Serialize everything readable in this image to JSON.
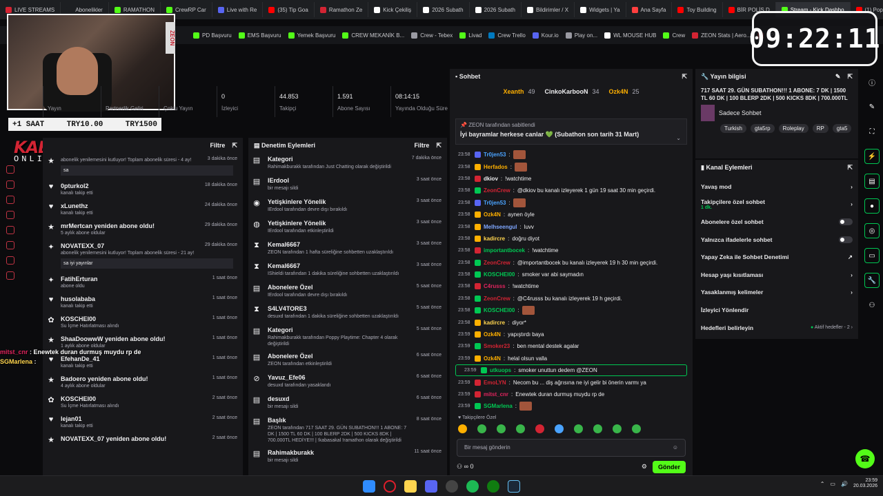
{
  "browser": {
    "tabs": [
      {
        "label": "LIVE STREAMS",
        "color": "#d32433"
      },
      {
        "label": "Abonelikler",
        "color": "#1d1f22"
      },
      {
        "label": "RAMATHON",
        "color": "#53fc18"
      },
      {
        "label": "CrewRP Car",
        "color": "#53fc18"
      },
      {
        "label": "Live with Re",
        "color": "#5865f2"
      },
      {
        "label": "(35) Tip Goa",
        "color": "#ff0000"
      },
      {
        "label": "Ramathon Ze",
        "color": "#d32433"
      },
      {
        "label": "Kick Çekiliş",
        "color": "#ffffff"
      },
      {
        "label": "2026 Subath",
        "color": "#ffffff"
      },
      {
        "label": "2026 Subath",
        "color": "#ffffff"
      },
      {
        "label": "Bildirimler / X",
        "color": "#ffffff"
      },
      {
        "label": "Widgets | Ya",
        "color": "#ffffff"
      },
      {
        "label": "Ana Sayfa",
        "color": "#ff3f3f"
      },
      {
        "label": "Toy Building",
        "color": "#ff0000"
      },
      {
        "label": "BİR POLİS D",
        "color": "#ff0000"
      },
      {
        "label": "Stream - Kick Dashbo",
        "color": "#53fc18",
        "active": true
      },
      {
        "label": "(1) Poppy Pl",
        "color": "#ff0000"
      }
    ],
    "bookmarks": [
      {
        "label": "PD Başvuru",
        "color": "#53fc18"
      },
      {
        "label": "EMS Başvuru",
        "color": "#53fc18"
      },
      {
        "label": "Yemek Başvuru",
        "color": "#53fc18"
      },
      {
        "label": "CREW MEKANİK B...",
        "color": "#53fc18"
      },
      {
        "label": "Crew - Tebex",
        "color": "#9a9aa2"
      },
      {
        "label": "Livad",
        "color": "#53fc18"
      },
      {
        "label": "Crew Trello",
        "color": "#0079bf"
      },
      {
        "label": "Kour.io",
        "color": "#5865f2"
      },
      {
        "label": "Play on...",
        "color": "#9a9aa2"
      },
      {
        "label": "WL MOUSE HUB",
        "color": "#ffffff"
      },
      {
        "label": "Crew",
        "color": "#53fc18"
      },
      {
        "label": "ZEON Stats | Aero...",
        "color": "#d32433"
      },
      {
        "label": "APIq",
        "color": "#ff3f3f"
      }
    ]
  },
  "overlay": {
    "clock": "09:22:11",
    "tip_left": "+1 SAAT",
    "tip_mid": "TRY10.00",
    "tip_right": "TRY1500",
    "logo_big": "KABASAKAL",
    "logo_small": "ONLINE.COM",
    "cam_brand": "ZEON",
    "chat": [
      {
        "user": "mitst_cnr",
        "text": "Enewtek duran durmuş muydu rp de",
        "color": "#e0245e"
      },
      {
        "user": "SGMarlena",
        "text": "",
        "color": "#ffd54f"
      }
    ]
  },
  "stats": [
    {
      "value": "",
      "label": "Yayın"
    },
    {
      "value": "",
      "label": "Partnerlik Geliri"
    },
    {
      "value": "",
      "label": "Çoklu Yayın"
    },
    {
      "value": "0",
      "label": "İzleyici"
    },
    {
      "value": "44.853",
      "label": "Takipçi"
    },
    {
      "value": "1.591",
      "label": "Abone Sayısı"
    },
    {
      "value": "08:14:15",
      "label": "Yayında Olduğu Süre"
    }
  ],
  "activity": {
    "header_filter": "Filtre",
    "items": [
      {
        "icon": "★",
        "name": "",
        "sub": "abonelik yenilemesini kutluyor! Toplam abonelik süresi - 4 ay!",
        "time": "3 dakika önce",
        "msg": "sa"
      },
      {
        "icon": "♥",
        "name": "0pturkol2",
        "sub": "kanalı takip etti",
        "time": "18 dakika önce"
      },
      {
        "icon": "♥",
        "name": "xLunethz",
        "sub": "kanalı takip etti",
        "time": "24 dakika önce"
      },
      {
        "icon": "★",
        "name": "mrMertcan yeniden abone oldu!",
        "sub": "5 aylık abone oldular",
        "time": "29 dakika önce"
      },
      {
        "icon": "✦",
        "name": "NOVATEXX_07",
        "sub": "abonelik yenilemesini kutluyor! Toplam abonelik süresi - 21 ay!",
        "time": "29 dakika önce",
        "msg": "sa iyi yayınlar"
      },
      {
        "icon": "✦",
        "name": "FatihErturan",
        "sub": "abone oldu",
        "time": "1 saat önce"
      },
      {
        "icon": "♥",
        "name": "husolababa",
        "sub": "kanalı takip etti",
        "time": "1 saat önce"
      },
      {
        "icon": "✿",
        "name": "KOSCHEI00",
        "sub": "Su İçme Hatırlatması alındı",
        "time": "1 saat önce"
      },
      {
        "icon": "★",
        "name": "ShaaDoowwW yeniden abone oldu!",
        "sub": "1 aylık abone oldular",
        "time": "1 saat önce"
      },
      {
        "icon": "♥",
        "name": "EfehanDe_41",
        "sub": "kanalı takip etti",
        "time": "1 saat önce"
      },
      {
        "icon": "★",
        "name": "Badoero yeniden abone oldu!",
        "sub": "4 aylık abone oldular",
        "time": "1 saat önce"
      },
      {
        "icon": "✿",
        "name": "KOSCHEI00",
        "sub": "Su İçme Hatırlatması alındı",
        "time": "2 saat önce"
      },
      {
        "icon": "♥",
        "name": "lejan01",
        "sub": "kanalı takip etti",
        "time": "2 saat önce"
      },
      {
        "icon": "★",
        "name": "NOVATEXX_07 yeniden abone oldu!",
        "sub": "",
        "time": "2 saat önce"
      }
    ]
  },
  "moderation": {
    "title": "Denetim Eylemleri",
    "filter": "Filtre",
    "items": [
      {
        "icon": "▤",
        "name": "Kategori",
        "sub": "Rahimakburakk tarafından Just Chatting olarak değiştirildi",
        "time": "7 dakika önce"
      },
      {
        "icon": "▤",
        "name": "IErdool",
        "sub": "bir mesajı sildi",
        "time": "3 saat önce"
      },
      {
        "icon": "◉",
        "name": "Yetişkinlere Yönelik",
        "sub": "IErdool tarafından devre dışı bırakıldı",
        "time": "3 saat önce"
      },
      {
        "icon": "◍",
        "name": "Yetişkinlere Yönelik",
        "sub": "IErdool tarafından etkinleştirildi",
        "time": "3 saat önce"
      },
      {
        "icon": "⧗",
        "name": "Kemal6667",
        "sub": "ZEON tarafından 1 hafta süreliğine sohbetten uzaklaştırıldı",
        "time": "3 saat önce"
      },
      {
        "icon": "⧗",
        "name": "Kemal6667",
        "sub": "IShieldi tarafından 1 dakika süreliğine sohbetten uzaklaştırıldı",
        "time": "3 saat önce"
      },
      {
        "icon": "▤",
        "name": "Abonelere Özel",
        "sub": "IErdool tarafından devre dışı bırakıldı",
        "time": "5 saat önce"
      },
      {
        "icon": "⧗",
        "name": "S4LV4TORE3",
        "sub": "desuxd tarafından 1 dakika süreliğine sohbetten uzaklaştırıldı",
        "time": "5 saat önce"
      },
      {
        "icon": "▤",
        "name": "Kategori",
        "sub": "Rahimakburakk tarafından Poppy Playtime: Chapter 4 olarak değiştirildi",
        "time": "5 saat önce"
      },
      {
        "icon": "▤",
        "name": "Abonelere Özel",
        "sub": "ZEON tarafından etkinleştirildi",
        "time": "6 saat önce"
      },
      {
        "icon": "⊘",
        "name": "Yavuz_Efe06",
        "sub": "desuxd tarafından yasaklandı",
        "time": "6 saat önce"
      },
      {
        "icon": "▤",
        "name": "desuxd",
        "sub": "bir mesajı sildi",
        "time": "6 saat önce"
      },
      {
        "icon": "▤",
        "name": "Başlık",
        "sub": "ZEON tarafından 717 SAAT 29. GÜN SUBATHON!!! 1 ABONE: 7 DK | 1500 TL 60 DK | 100 BLERP 2DK | 500 KICKS 8DK | 700.000TL HEDİYE!!! | !kabasakal !ramathon olarak değiştirildi",
        "time": "8 saat önce"
      },
      {
        "icon": "▤",
        "name": "Rahimakburakk",
        "sub": "bir mesajı sildi",
        "time": "11 saat önce"
      }
    ]
  },
  "chat": {
    "title": "Sohbet",
    "leaders": [
      {
        "rank": "1",
        "name": "Xeanth",
        "count": "49",
        "color": "#ffb000"
      },
      {
        "rank": "",
        "name": "CinkoKarbooN",
        "count": "34",
        "color": "#efeff1"
      },
      {
        "rank": "",
        "name": "Ozk4N",
        "count": "25",
        "color": "#ffb000"
      }
    ],
    "pinned_by": "ZEON tarafından sabitlendi",
    "pinned_text": "İyi bayramlar herkese canlar 💚 (Subathon son tarih 31 Mart)",
    "messages": [
      {
        "t": "23:58",
        "u": "Tr0jen53",
        "c": "#4aa3ff",
        "m": "",
        "e": true,
        "b": "#5865f2"
      },
      {
        "t": "23:58",
        "u": "Herfados",
        "c": "#ffb000",
        "m": "",
        "e": true,
        "b": "#ffb000"
      },
      {
        "t": "23:58",
        "u": "dkiov",
        "c": "#efeff1",
        "m": "!watchtime",
        "b": "#d32433"
      },
      {
        "t": "23:58",
        "u": "ZeonCrew",
        "c": "#d32433",
        "m": "@dkiov bu kanalı izleyerek 1 gün 19 saat 30 min geçirdi.",
        "b": "#00c853"
      },
      {
        "t": "23:58",
        "u": "Tr0jen53",
        "c": "#4aa3ff",
        "m": "",
        "e": true,
        "b": "#5865f2"
      },
      {
        "t": "23:58",
        "u": "Ozk4N",
        "c": "#ffb000",
        "m": "aynen öyle",
        "b": "#ffb000"
      },
      {
        "t": "23:58",
        "u": "Melhseengul",
        "c": "#7fa7ff",
        "m": "luvv",
        "b": "#ffb000"
      },
      {
        "t": "23:58",
        "u": "kadircre",
        "c": "#ffd54f",
        "m": "doğru diyot",
        "b": "#ffb000"
      },
      {
        "t": "23:58",
        "u": "importantbocek",
        "c": "#00c853",
        "m": "!watchtime",
        "b": "#d32433"
      },
      {
        "t": "23:58",
        "u": "ZeonCrew",
        "c": "#d32433",
        "m": "@importantbocek bu kanalı izleyerek 19 h 30 min geçirdi.",
        "b": "#00c853"
      },
      {
        "t": "23:58",
        "u": "KOSCHEI00",
        "c": "#00c853",
        "m": "smoker var abi saymadın",
        "b": "#00c853"
      },
      {
        "t": "23:58",
        "u": "C4russs",
        "c": "#e0245e",
        "m": "!watchtime",
        "b": "#d32433"
      },
      {
        "t": "23:58",
        "u": "ZeonCrew",
        "c": "#d32433",
        "m": "@C4russs bu kanalı izleyerek 19 h geçirdi.",
        "b": "#00c853"
      },
      {
        "t": "23:58",
        "u": "KOSCHEI00",
        "c": "#00c853",
        "m": "",
        "e": true,
        "b": "#00c853"
      },
      {
        "t": "23:58",
        "u": "kadircre",
        "c": "#ffd54f",
        "m": "diyor*",
        "b": "#ffb000"
      },
      {
        "t": "23:59",
        "u": "Ozk4N",
        "c": "#ffb000",
        "m": "yapıştırdı baya",
        "b": "#ffb000"
      },
      {
        "t": "23:59",
        "u": "Smoker23",
        "c": "#d32433",
        "m": "ben mental destek agalar",
        "b": "#00c853"
      },
      {
        "t": "23:59",
        "u": "Ozk4N",
        "c": "#ffb000",
        "m": "helal olsun valla",
        "b": "#ffb000"
      },
      {
        "t": "23:59",
        "u": "utkuops",
        "c": "#00c853",
        "m": "smoker unuttun dedem @ZEON",
        "b": "#00c853",
        "sel": true
      },
      {
        "t": "23:59",
        "u": "EmoLYN",
        "c": "#d32433",
        "m": "Necom bu ... diş ağrısına ne iyi gelir bi önerin varmı ya",
        "b": "#d32433"
      },
      {
        "t": "23:59",
        "u": "mitst_cnr",
        "c": "#e0245e",
        "m": "Enewtek duran durmuş muydu rp de",
        "b": "#d32433"
      },
      {
        "t": "23:59",
        "u": "SGMarlena",
        "c": "#00c853",
        "m": "",
        "e": true,
        "b": "#00c853"
      }
    ],
    "followers_only": "Takipçilere Özel",
    "placeholder": "Bir mesaj gönderin",
    "points": "0",
    "send": "Gönder"
  },
  "info": {
    "title": "Yayın bilgisi",
    "stream_title": "717 SAAT 29. GÜN SUBATHON!!! 1 ABONE: 7 DK | 1500 TL 60 DK | 100 BLERP 2DK | 500 KICKS 8DK | 700.000TL",
    "category": "Sadece Sohbet",
    "tags": [
      "Turkish",
      "gta5rp",
      "Roleplay",
      "RP",
      "gta5"
    ]
  },
  "channel": {
    "title": "Kanal Eylemleri",
    "items": [
      {
        "label": "Yavaş mod",
        "ctrl": "chevron"
      },
      {
        "label": "Takipçilere özel sohbet",
        "sub": "1 dk.",
        "ctrl": "chevron"
      },
      {
        "label": "Abonelere özel sohbet",
        "ctrl": "toggle"
      },
      {
        "label": "Yalnızca ifadelerle sohbet",
        "ctrl": "toggle"
      },
      {
        "label": "Yapay Zeka ile Sohbet Denetimi",
        "ctrl": "ext"
      },
      {
        "label": "Hesap yaşı kısıtlaması",
        "ctrl": "chevron"
      },
      {
        "label": "Yasaklanmış kelimeler",
        "ctrl": "chevron"
      },
      {
        "label": "İzleyici Yönlendir",
        "ctrl": "none"
      },
      {
        "label": "Hedefleri belirleyin",
        "ctrl": "goal",
        "goal": "Aktif hedefler - 2"
      }
    ]
  },
  "taskbar": {
    "time": "23:59",
    "date": "20.03.2026"
  }
}
